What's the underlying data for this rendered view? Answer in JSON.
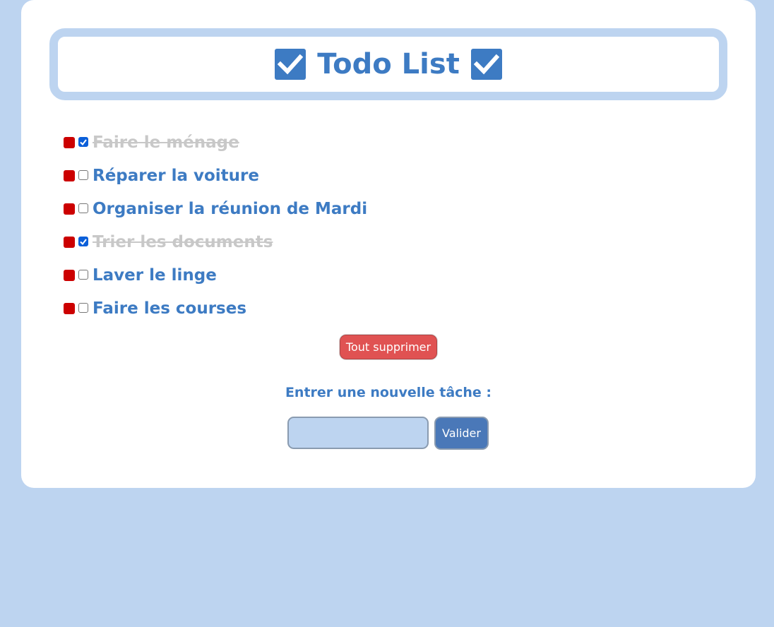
{
  "header": {
    "title": "Todo List",
    "icon": "ballot-box-with-check-icon"
  },
  "tasks": [
    {
      "label": "Faire le ménage",
      "done": true
    },
    {
      "label": "Réparer la voiture",
      "done": false
    },
    {
      "label": "Organiser la réunion de Mardi",
      "done": false
    },
    {
      "label": "Trier les documents",
      "done": true
    },
    {
      "label": "Laver le linge",
      "done": false
    },
    {
      "label": "Faire les courses",
      "done": false
    }
  ],
  "actions": {
    "delete_all_label": "Tout supprimer"
  },
  "new_task": {
    "prompt": "Entrer une nouvelle tâche :",
    "input_value": "",
    "submit_label": "Valider"
  },
  "colors": {
    "background": "#bdd4f0",
    "accent": "#3d7bc3",
    "delete": "#cc0000",
    "delete_all": "#e05252",
    "done_text": "#c8c8c8"
  }
}
